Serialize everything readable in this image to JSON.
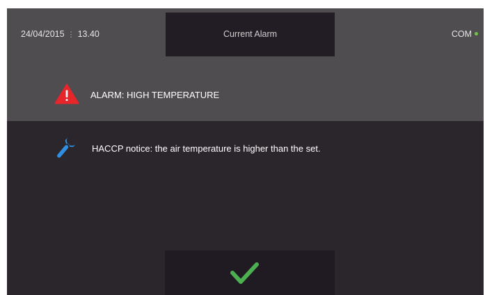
{
  "header": {
    "date": "24/04/2015",
    "separator": "⋮",
    "time": "13.40",
    "title": "Current Alarm",
    "com_label": "COM",
    "com_status_color": "#73c24a"
  },
  "alarm": {
    "icon": "warning-triangle-icon",
    "icon_color": "#e7262c",
    "text": "ALARM: HIGH TEMPERATURE"
  },
  "notice": {
    "icon": "wrench-icon",
    "icon_color": "#2f8fe0",
    "text": "HACCP notice: the air temperature is higher than the set."
  },
  "confirm_button": {
    "icon": "check-icon",
    "icon_color": "#4caf50"
  },
  "colors": {
    "header_bg": "#4f4d50",
    "body_bg": "#2b262c",
    "tab_bg": "#221c24"
  }
}
